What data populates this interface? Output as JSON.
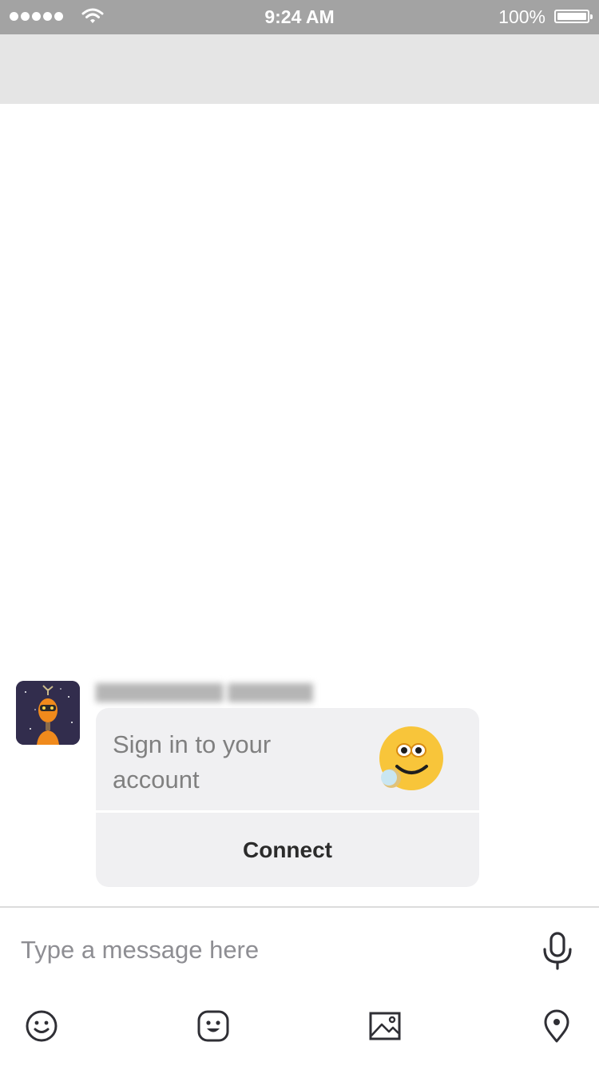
{
  "status_bar": {
    "time": "9:24 AM",
    "battery_percent": "100%",
    "battery_level": 1.0,
    "signal_dots": 5,
    "icons": [
      "signal-dots-icon",
      "wifi-icon",
      "battery-icon"
    ]
  },
  "conversation": {
    "message": {
      "avatar_icon": "bot-avatar-icon",
      "card": {
        "title": "Sign in to your account",
        "emoji_icon": "smiley-emoji-icon",
        "action_label": "Connect"
      }
    }
  },
  "composer": {
    "placeholder": "Type a message here",
    "mic_icon": "microphone-icon"
  },
  "toolbar": {
    "items": [
      {
        "icon": "emoji-icon"
      },
      {
        "icon": "sticker-icon"
      },
      {
        "icon": "image-icon"
      },
      {
        "icon": "location-pin-icon"
      }
    ]
  },
  "colors": {
    "status_bar_bg": "#a3a3a3",
    "header_band_bg": "#e5e5e5",
    "card_bg": "#f0f0f2",
    "card_title": "#808080",
    "card_action": "#2b2b2b",
    "emoji_yellow": "#f8c53a",
    "icon_dark": "#2f2f35"
  }
}
